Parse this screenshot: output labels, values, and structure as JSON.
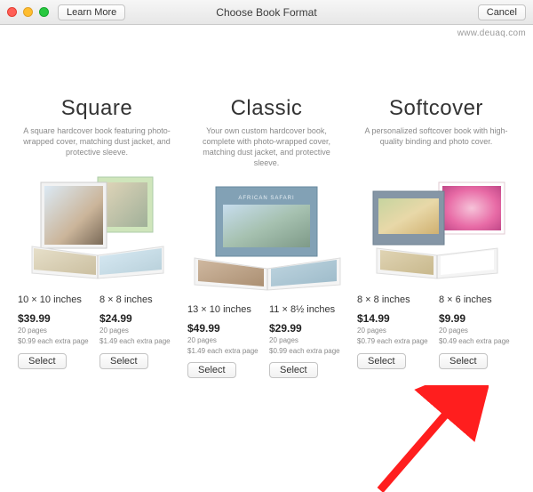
{
  "titlebar": {
    "learn_more": "Learn More",
    "title": "Choose Book Format",
    "cancel": "Cancel"
  },
  "watermark": "www.deuaq.com",
  "formats": [
    {
      "title": "Square",
      "desc": "A square hardcover book featuring photo-wrapped cover, matching dust jacket, and protective sleeve.",
      "options": [
        {
          "size": "10 × 10 inches",
          "price": "$39.99",
          "pages": "20 pages",
          "extra": "$0.99 each extra page",
          "select": "Select"
        },
        {
          "size": "8 × 8 inches",
          "price": "$24.99",
          "pages": "20 pages",
          "extra": "$1.49 each extra page",
          "select": "Select"
        }
      ]
    },
    {
      "title": "Classic",
      "desc": "Your own custom hardcover book, complete with photo-wrapped cover, matching dust jacket, and protective sleeve.",
      "options": [
        {
          "size": "13 × 10 inches",
          "price": "$49.99",
          "pages": "20 pages",
          "extra": "$1.49 each extra page",
          "select": "Select"
        },
        {
          "size": "11 × 8½ inches",
          "price": "$29.99",
          "pages": "20 pages",
          "extra": "$0.99 each extra page",
          "select": "Select"
        }
      ]
    },
    {
      "title": "Softcover",
      "desc": "A personalized softcover book with high-quality binding and photo cover.",
      "options": [
        {
          "size": "8 × 8 inches",
          "price": "$14.99",
          "pages": "20 pages",
          "extra": "$0.79 each extra page",
          "select": "Select"
        },
        {
          "size": "8 × 6 inches",
          "price": "$9.99",
          "pages": "20 pages",
          "extra": "$0.49 each extra page",
          "select": "Select"
        }
      ]
    }
  ]
}
